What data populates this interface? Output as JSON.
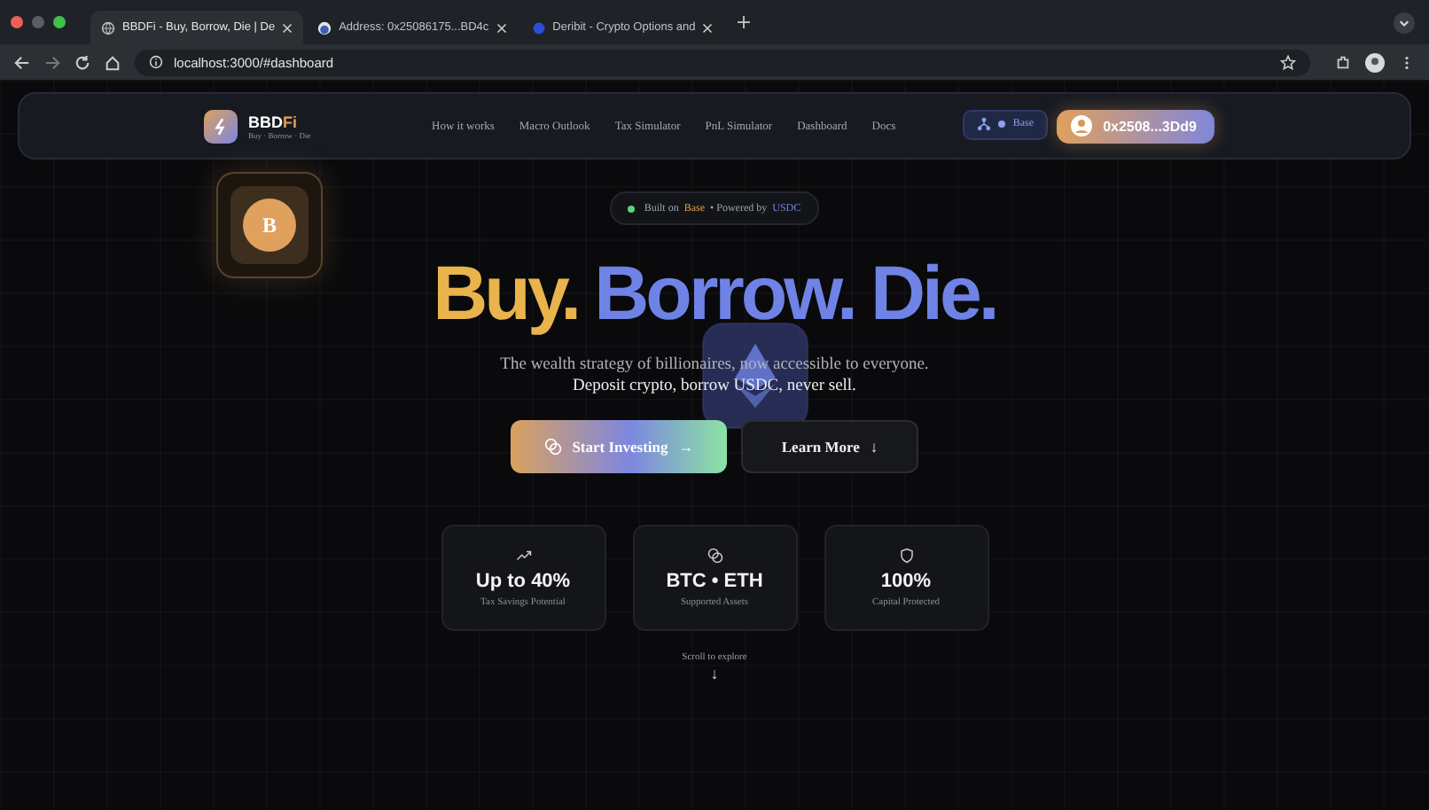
{
  "browser": {
    "tabs": [
      {
        "title": "BBDFi - Buy, Borrow, Die | De",
        "selected": true
      },
      {
        "title": "Address: 0x25086175...BD4c",
        "selected": false
      },
      {
        "title": "Deribit - Crypto Options and",
        "selected": false
      }
    ],
    "url": "localhost:3000/#dashboard"
  },
  "nav": {
    "brand_accent": "Fi",
    "brand_main": "BBD",
    "tagline": "Buy · Borrow · Die",
    "links": [
      "How it works",
      "Macro Outlook",
      "Tax Simulator",
      "PnL Simulator",
      "Dashboard",
      "Docs"
    ],
    "network": "Base",
    "wallet": "0x2508...3Dd9"
  },
  "hero": {
    "coin_letter": "B",
    "badge": [
      {
        "text": "Built on",
        "color": "#9ea3ad"
      },
      {
        "text": "Base",
        "color": "#e0a055"
      },
      {
        "text": "• Powered by",
        "color": "#9ea3ad"
      },
      {
        "text": "USDC",
        "color": "#6f83e6"
      }
    ],
    "headline": [
      {
        "text": "Buy.",
        "color": "#e9b44c"
      },
      {
        "text": "Borrow.",
        "color": "#6f83e6"
      },
      {
        "text": "Die.",
        "color": "#6f83e6"
      }
    ],
    "subtitle": "The wealth strategy of billionaires, now accessible to everyone.",
    "subtitle_2": "Deposit crypto, borrow USDC, never sell.",
    "primary_button": "Start Investing",
    "primary_arrow": "→",
    "secondary_button": "Learn More",
    "secondary_arrow": "↓",
    "stats": [
      {
        "kind": "trend",
        "value": "Up to 40%",
        "label": "Tax Savings Potential"
      },
      {
        "kind": "coins",
        "value": "BTC • ETH",
        "label": "Supported Assets"
      },
      {
        "kind": "shield",
        "value": "100%",
        "label": "Capital Protected"
      }
    ],
    "scroll_hint": "Scroll to explore",
    "scroll_arrow": "↓"
  }
}
